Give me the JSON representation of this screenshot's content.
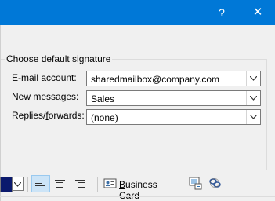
{
  "titlebar": {
    "help_label": "?",
    "close_label": "✕",
    "color": "#0078d7"
  },
  "signature_group": {
    "title": "Choose default signature",
    "email_account_label": "E-mail account:",
    "email_account_value": "sharedmailbox@company.com",
    "new_messages_label": "New messages:",
    "new_messages_value": "Sales",
    "replies_label": "Replies/forwards:",
    "replies_value": "(none)"
  },
  "toolbar": {
    "business_card_label": "Business Card",
    "font_color": "#0b1a6d",
    "icons": [
      "align-left-icon",
      "align-center-icon",
      "align-right-icon",
      "business-card-icon",
      "insert-picture-icon",
      "hyperlink-icon"
    ]
  }
}
